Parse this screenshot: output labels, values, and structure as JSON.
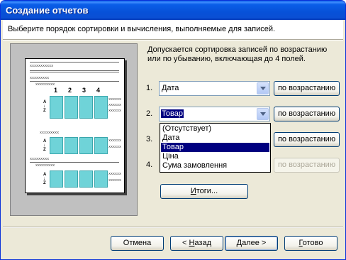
{
  "window": {
    "title": "Создание отчетов"
  },
  "instruction": "Выберите порядок сортировки и вычисления, выполняемые для записей.",
  "description": {
    "line1": "Допускается сортировка записей по возрастанию",
    "line2": "или по убыванию, включающая до 4 полей."
  },
  "preview": {
    "placeholder": "xxxxxxxxxxx",
    "short_placeholder": "xxxxxxxxx",
    "cell_placeholder": "xxxxxx",
    "column_numbers": [
      "1",
      "2",
      "3",
      "4"
    ],
    "sort_symbol_a": "A",
    "sort_symbol_z": "Z"
  },
  "sort_rows": [
    {
      "number": "1.",
      "value": "Дата",
      "order_label": "по возрастанию",
      "order_enabled": true
    },
    {
      "number": "2.",
      "value": "Товар",
      "order_label": "по возрастанию",
      "order_enabled": true
    },
    {
      "number": "3.",
      "value": "",
      "order_label": "по возрастанию",
      "order_enabled": true
    },
    {
      "number": "4.",
      "value": "",
      "order_label": "по возрастанию",
      "order_enabled": false
    }
  ],
  "dropdown": {
    "options": [
      "(Отсутствует)",
      "Дата",
      "Товар",
      "Ціна",
      "Сума замовлення"
    ],
    "selected": "Товар"
  },
  "summary_button": {
    "label": "Итоги...",
    "underline": "И",
    "rest": "тоги..."
  },
  "footer": {
    "cancel": "Отмена",
    "back_prefix": "< ",
    "back_ul": "Н",
    "back_rest": "азад",
    "next_ul": "Д",
    "next_rest": "алее >",
    "finish_ul": "Г",
    "finish_rest": "отово"
  },
  "colors": {
    "titlebar": "#0a5ee8",
    "selection": "#000080",
    "preview_cell": "#6fd3d8"
  }
}
